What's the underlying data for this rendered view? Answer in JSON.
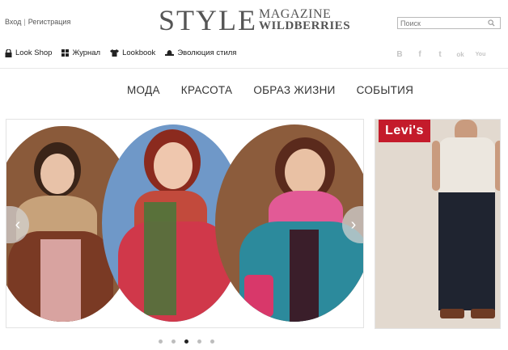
{
  "auth": {
    "login": "Вход",
    "separator": "|",
    "register": "Регистрация"
  },
  "logo": {
    "big": "STYLE",
    "top": "MAGAZINE",
    "bottom": "WILDBERRIES"
  },
  "search": {
    "placeholder": "Поиск",
    "icon": "search-icon"
  },
  "nav": [
    {
      "label": "Look Shop",
      "icon": "lock-icon"
    },
    {
      "label": "Журнал",
      "icon": "grid-icon"
    },
    {
      "label": "Lookbook",
      "icon": "tshirt-icon"
    },
    {
      "label": "Эволюция стиля",
      "icon": "hat-icon"
    }
  ],
  "social": [
    {
      "glyph": "B",
      "icon": "vk-icon"
    },
    {
      "glyph": "f",
      "icon": "facebook-icon"
    },
    {
      "glyph": "t",
      "icon": "twitter-icon"
    },
    {
      "glyph": "ok",
      "icon": "odnoklassniki-icon"
    },
    {
      "glyph": "You",
      "icon": "youtube-icon"
    }
  ],
  "menu": [
    "МОДА",
    "КРАСОТА",
    "ОБРАЗ ЖИЗНИ",
    "СОБЫТИЯ"
  ],
  "slider": {
    "prev": "‹",
    "next": "›",
    "dots": 5,
    "active_dot": 3
  },
  "ad": {
    "brand": "Levi's"
  },
  "colors": {
    "brand_red": "#c41b2b",
    "text": "#333333",
    "border": "#e3e3e3"
  }
}
